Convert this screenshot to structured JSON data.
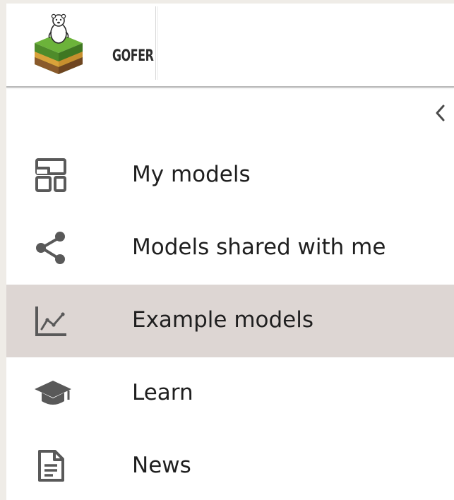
{
  "brand": {
    "name": "GOFER"
  },
  "sidebar": {
    "collapse_icon": "chevron-left-icon",
    "items": [
      {
        "label": "My models",
        "icon": "dashboard-icon",
        "active": false
      },
      {
        "label": "Models shared with me",
        "icon": "share-icon",
        "active": false
      },
      {
        "label": "Example models",
        "icon": "line-chart-icon",
        "active": true
      },
      {
        "label": "Learn",
        "icon": "graduation-cap-icon",
        "active": false
      },
      {
        "label": "News",
        "icon": "document-icon",
        "active": false
      }
    ]
  },
  "colors": {
    "background": "#efece7",
    "panel": "#ffffff",
    "active_item": "#ddd6d3",
    "icon": "#595959",
    "text": "#1f1f1f"
  }
}
